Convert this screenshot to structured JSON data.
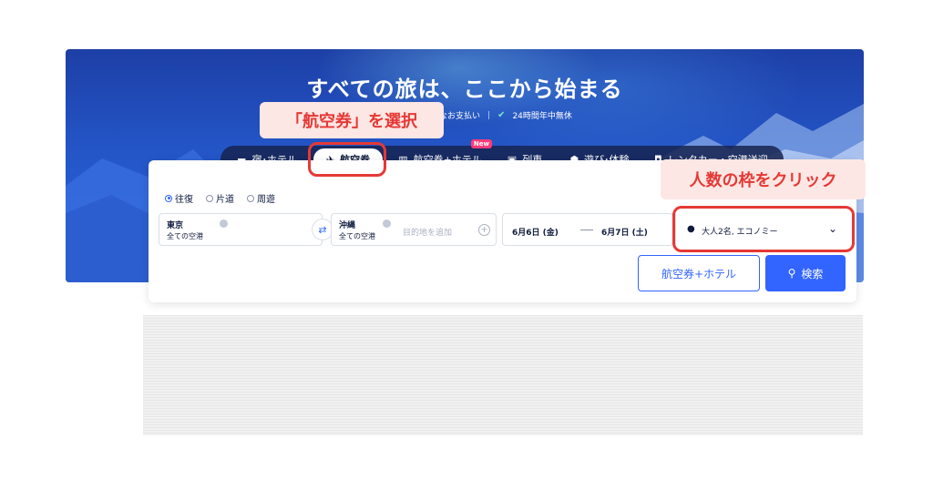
{
  "hero": {
    "title": "すべての旅は、ここから始まる",
    "subtitle_payment": "なお支払い",
    "subtitle_support": "24時間年中無休"
  },
  "tabs": [
    {
      "label": "宿･ホテル",
      "icon": "bed-icon",
      "active": false
    },
    {
      "label": "航空券",
      "icon": "plane-icon",
      "active": true
    },
    {
      "label": "航空券+ホテル",
      "icon": "building-icon",
      "active": false,
      "badge": "New"
    },
    {
      "label": "列車",
      "icon": "train-icon",
      "active": false
    },
    {
      "label": "遊び･体験",
      "icon": "ticket-icon",
      "active": false
    },
    {
      "label": "レンタカー・空港送迎",
      "icon": "car-icon",
      "active": false
    }
  ],
  "trip_type": {
    "options": [
      "往復",
      "片道",
      "周遊"
    ],
    "selected": "往復"
  },
  "search_form": {
    "origin_city": "東京",
    "origin_sub": "全ての空港",
    "destination_city": "沖縄",
    "destination_sub": "全ての空港",
    "add_destination_placeholder": "目的地を追加",
    "depart_date": "6月6日 (金)",
    "return_date": "6月7日 (土)",
    "passengers": "大人2名, エコノミー",
    "bundle_button": "航空券+ホテル",
    "search_button": "検索"
  },
  "annotations": {
    "callout_flight": "「航空券」を選択",
    "callout_passengers": "人数の枠をクリック",
    "highlight_color": "#e53935"
  },
  "colors": {
    "primary": "#3264ff",
    "hero_blue": "#2456c8"
  }
}
